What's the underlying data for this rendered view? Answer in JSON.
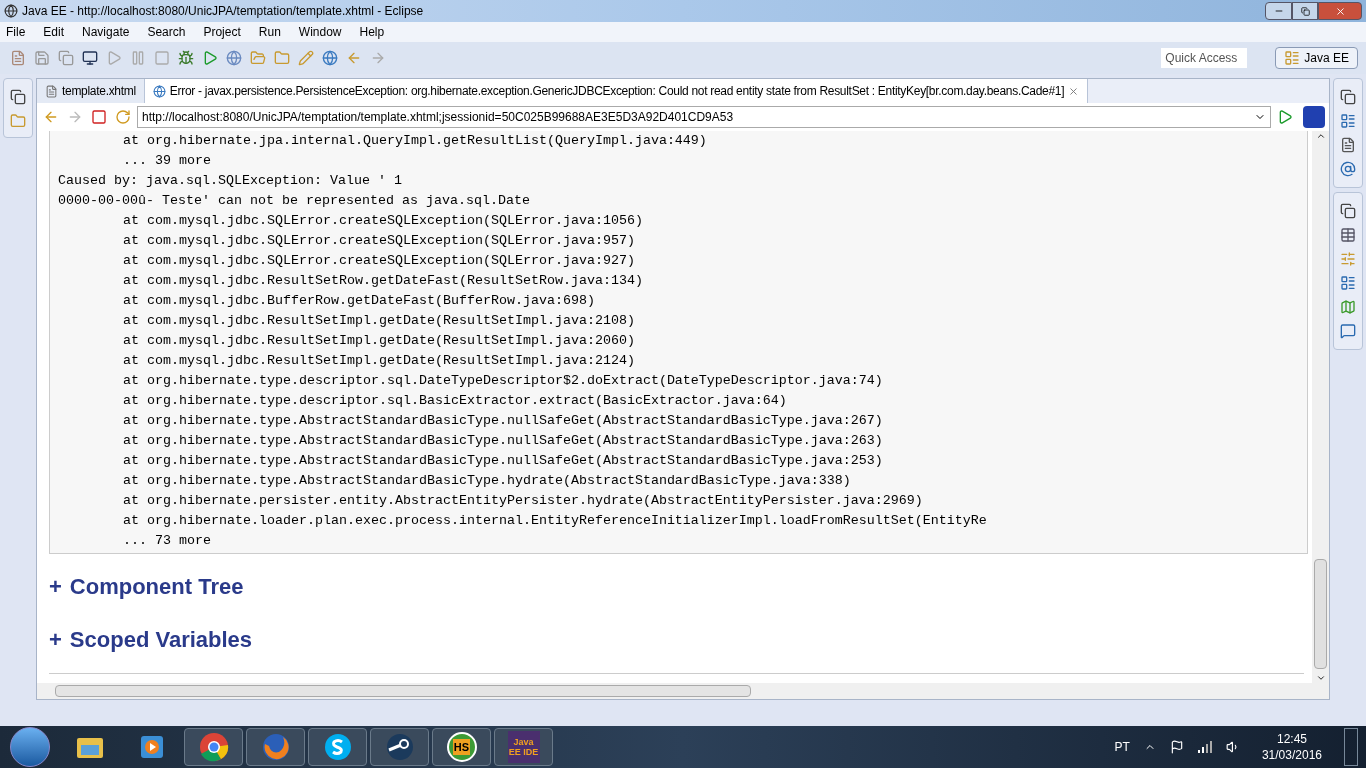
{
  "window": {
    "title": "Java EE - http://localhost:8080/UnicJPA/temptation/template.xhtml - Eclipse"
  },
  "menu": [
    "File",
    "Edit",
    "Navigate",
    "Search",
    "Project",
    "Run",
    "Window",
    "Help"
  ],
  "quick_access": {
    "placeholder": "Quick Access"
  },
  "perspective": {
    "label": "Java EE",
    "selected": true
  },
  "editor_tabs": [
    {
      "label": "template.xhtml",
      "selected": false,
      "kind": "file"
    },
    {
      "label": "Error - javax.persistence.PersistenceException: org.hibernate.exception.GenericJDBCException: Could not read entity state from ResultSet : EntityKey[br.com.day.beans.Cade#1]",
      "selected": true,
      "kind": "web"
    }
  ],
  "browser": {
    "url": "http://localhost:8080/UnicJPA/temptation/template.xhtml;jsessionid=50C025B99688AE3E5D3A92D401CD9A53"
  },
  "stack_trace": [
    {
      "kind": "frame",
      "text": "at org.hibernate.jpa.internal.QueryImpl.getResultList(QueryImpl.java:449)"
    },
    {
      "kind": "frame",
      "text": "... 39 more"
    },
    {
      "kind": "message",
      "text": "Caused by: java.sql.SQLException: Value ' 1"
    },
    {
      "kind": "message",
      "text": "0000-00-00û- Teste' can not be represented as java.sql.Date"
    },
    {
      "kind": "frame",
      "text": "at com.mysql.jdbc.SQLError.createSQLException(SQLError.java:1056)"
    },
    {
      "kind": "frame",
      "text": "at com.mysql.jdbc.SQLError.createSQLException(SQLError.java:957)"
    },
    {
      "kind": "frame",
      "text": "at com.mysql.jdbc.SQLError.createSQLException(SQLError.java:927)"
    },
    {
      "kind": "frame",
      "text": "at com.mysql.jdbc.ResultSetRow.getDateFast(ResultSetRow.java:134)"
    },
    {
      "kind": "frame",
      "text": "at com.mysql.jdbc.BufferRow.getDateFast(BufferRow.java:698)"
    },
    {
      "kind": "frame",
      "text": "at com.mysql.jdbc.ResultSetImpl.getDate(ResultSetImpl.java:2108)"
    },
    {
      "kind": "frame",
      "text": "at com.mysql.jdbc.ResultSetImpl.getDate(ResultSetImpl.java:2060)"
    },
    {
      "kind": "frame",
      "text": "at com.mysql.jdbc.ResultSetImpl.getDate(ResultSetImpl.java:2124)"
    },
    {
      "kind": "frame",
      "text": "at org.hibernate.type.descriptor.sql.DateTypeDescriptor$2.doExtract(DateTypeDescriptor.java:74)"
    },
    {
      "kind": "frame",
      "text": "at org.hibernate.type.descriptor.sql.BasicExtractor.extract(BasicExtractor.java:64)"
    },
    {
      "kind": "frame",
      "text": "at org.hibernate.type.AbstractStandardBasicType.nullSafeGet(AbstractStandardBasicType.java:267)"
    },
    {
      "kind": "frame",
      "text": "at org.hibernate.type.AbstractStandardBasicType.nullSafeGet(AbstractStandardBasicType.java:263)"
    },
    {
      "kind": "frame",
      "text": "at org.hibernate.type.AbstractStandardBasicType.nullSafeGet(AbstractStandardBasicType.java:253)"
    },
    {
      "kind": "frame",
      "text": "at org.hibernate.type.AbstractStandardBasicType.hydrate(AbstractStandardBasicType.java:338)"
    },
    {
      "kind": "frame",
      "text": "at org.hibernate.persister.entity.AbstractEntityPersister.hydrate(AbstractEntityPersister.java:2969)"
    },
    {
      "kind": "frame",
      "text": "at org.hibernate.loader.plan.exec.process.internal.EntityReferenceInitializerImpl.loadFromResultSet(EntityRe"
    },
    {
      "kind": "frame",
      "text": "... 73 more"
    }
  ],
  "sections": [
    {
      "toggle": "+",
      "title": "Component Tree"
    },
    {
      "toggle": "+",
      "title": "Scoped Variables"
    }
  ],
  "taskbar": {
    "apps": [
      {
        "kind": "explorer",
        "pinned": false
      },
      {
        "kind": "media",
        "pinned": false
      },
      {
        "kind": "chrome",
        "pinned": true
      },
      {
        "kind": "firefox",
        "pinned": true
      },
      {
        "kind": "skype",
        "pinned": true
      },
      {
        "kind": "steam",
        "pinned": true
      },
      {
        "kind": "hs",
        "pinned": true,
        "label": "HS"
      },
      {
        "kind": "eclipse",
        "pinned": true,
        "label": "Java EE IDE"
      }
    ],
    "language": "PT",
    "time": "12:45",
    "date": "31/03/2016"
  }
}
